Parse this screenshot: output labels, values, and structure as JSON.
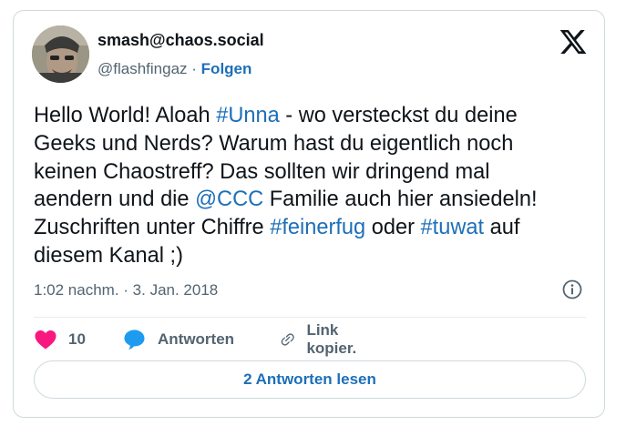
{
  "author": {
    "display_name": "smash@chaos.social",
    "handle": "@flashfingaz",
    "separator": "·",
    "follow_label": "Folgen"
  },
  "logo_icon": "x-logo-icon",
  "post": {
    "lines": [
      [
        {
          "t": "Hello World! Aloah "
        },
        {
          "t": "#Unna",
          "tag": true
        },
        {
          "t": " - wo versteckst du deine"
        }
      ],
      [
        {
          "t": "Geeks und Nerds? Warum hast du eigentlich noch"
        }
      ],
      [
        {
          "t": "keinen Chaostreff? Das sollten wir dringend mal"
        }
      ],
      [
        {
          "t": "aendern und die "
        },
        {
          "t": "@CCC",
          "tag": true
        },
        {
          "t": " Familie auch hier ansiedeln!"
        }
      ],
      [
        {
          "t": "Zuschriften unter Chiffre "
        },
        {
          "t": "#feinerfug",
          "tag": true
        },
        {
          "t": " oder "
        },
        {
          "t": "#tuwat",
          "tag": true
        },
        {
          "t": " auf"
        }
      ],
      [
        {
          "t": "diesem Kanal ;)"
        }
      ]
    ],
    "timestamp": "1:02 nachm. · 3. Jan. 2018"
  },
  "actions": {
    "like_count": "10",
    "reply_label": "Antworten",
    "copy_link_label": "Link kopier."
  },
  "read_replies_label": "2 Antworten lesen",
  "colors": {
    "link": "#1d6fb8",
    "like": "#f91880",
    "reply_icon": "#1d9bf0",
    "secondary_text": "#536471"
  }
}
